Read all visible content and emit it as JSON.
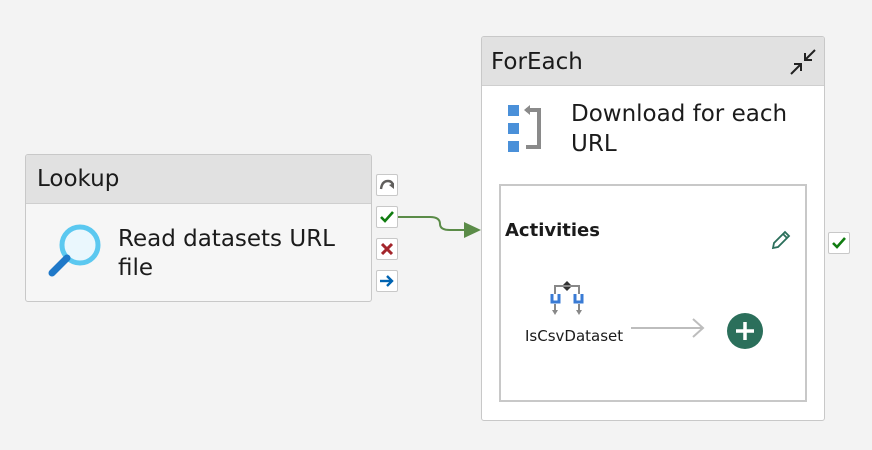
{
  "lookup": {
    "type_label": "Lookup",
    "name_line1": "Read datasets URL",
    "name_line2": "file",
    "icon": "search-icon",
    "ports": [
      "skip-icon",
      "success-check-icon",
      "failure-x-icon",
      "completion-arrow-icon"
    ]
  },
  "foreach": {
    "type_label": "ForEach",
    "name_line1": "Download for each",
    "name_line2": "URL",
    "icon": "foreach-icon",
    "collapse_icon": "collapse-icon",
    "activities": {
      "title": "Activities",
      "edit_icon": "pencil-icon",
      "inner_name": "IsCsvDataset",
      "inner_icon": "if-condition-icon",
      "add_icon": "plus-icon"
    },
    "side_port": "success-check-icon"
  },
  "colors": {
    "connector": "#5a8b47",
    "check": "#107c10",
    "fail": "#a4262c",
    "skip": "#605e5c",
    "completion": "#0063b1",
    "plus_bg": "#2b6f5b",
    "accent_blue": "#4a90d9"
  }
}
